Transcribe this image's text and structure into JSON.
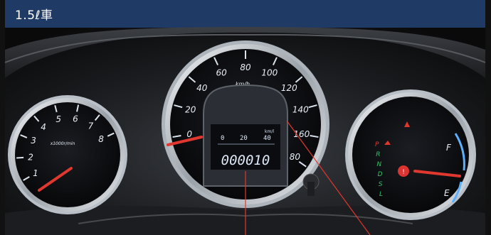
{
  "header": {
    "title": "1.5ℓ車"
  },
  "tachometer": {
    "numbers": [
      "1",
      "2",
      "3",
      "4",
      "5",
      "6",
      "7",
      "8"
    ],
    "unit": "x1000r/min"
  },
  "speedometer": {
    "numbers": [
      "0",
      "20",
      "40",
      "60",
      "80",
      "100",
      "120",
      "140",
      "160",
      "180"
    ],
    "unit": "km/h"
  },
  "multi_display": {
    "scale_labels": [
      "0",
      "20",
      "40"
    ],
    "scale_unit": "km/l",
    "odometer": "000010"
  },
  "fuel_gauge": {
    "full": "F",
    "empty": "E",
    "gear_positions": [
      "P",
      "R",
      "N",
      "D",
      "S",
      "L"
    ]
  },
  "colors": {
    "title_bar": "#203a66",
    "needle": "#e0382e",
    "lcd_text": "#dfe9f7",
    "gauge_ring": "#d8dde3"
  }
}
